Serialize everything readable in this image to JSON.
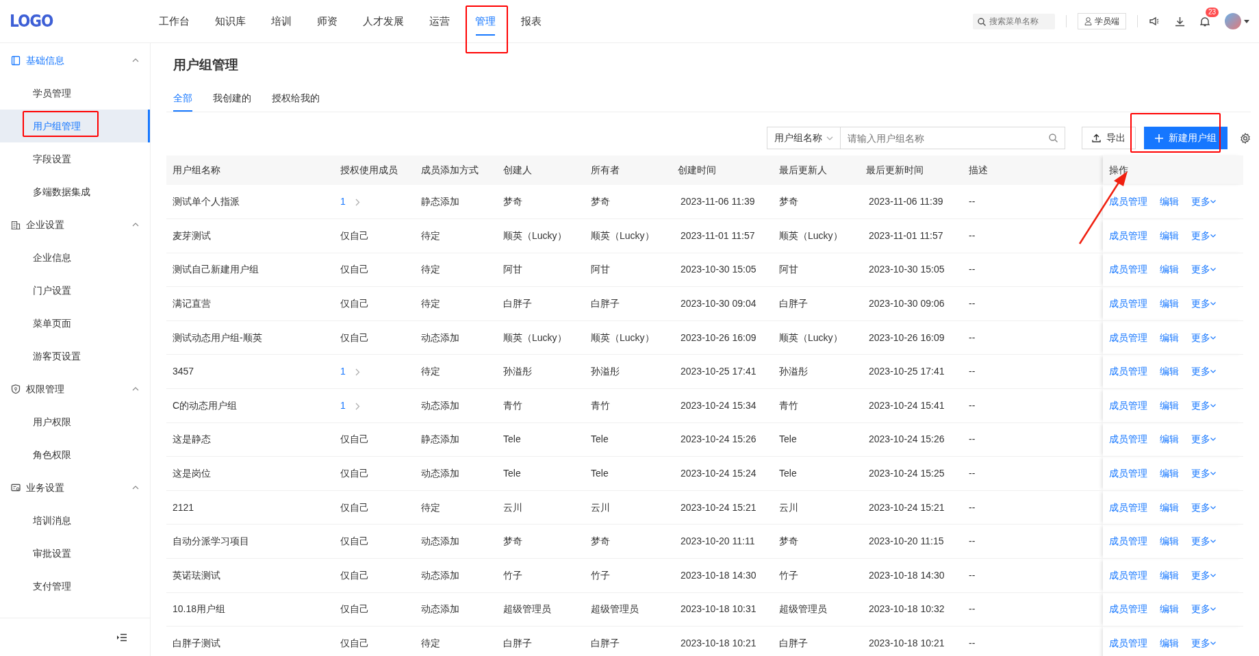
{
  "logo": "LOGO",
  "nav": [
    {
      "label": "工作台",
      "selected": false,
      "highlighted": false
    },
    {
      "label": "知识库",
      "selected": false,
      "highlighted": false
    },
    {
      "label": "培训",
      "selected": false,
      "highlighted": false
    },
    {
      "label": "师资",
      "selected": false,
      "highlighted": false
    },
    {
      "label": "人才发展",
      "selected": false,
      "highlighted": false
    },
    {
      "label": "运营",
      "selected": false,
      "highlighted": false
    },
    {
      "label": "管理",
      "selected": true,
      "highlighted": true
    },
    {
      "label": "报表",
      "selected": false,
      "highlighted": false
    }
  ],
  "header": {
    "search_placeholder": "搜索菜单名称",
    "student_button": "学员端",
    "notification_count": "23"
  },
  "sidebar": {
    "groups": [
      {
        "label": "基础信息",
        "selected": true,
        "expanded": true,
        "items": [
          {
            "label": "学员管理",
            "selected": false,
            "highlighted": false
          },
          {
            "label": "用户组管理",
            "selected": true,
            "highlighted": true
          },
          {
            "label": "字段设置",
            "selected": false,
            "highlighted": false
          },
          {
            "label": "多端数据集成",
            "selected": false,
            "highlighted": false
          }
        ]
      },
      {
        "label": "企业设置",
        "selected": false,
        "expanded": true,
        "items": [
          {
            "label": "企业信息",
            "selected": false,
            "highlighted": false
          },
          {
            "label": "门户设置",
            "selected": false,
            "highlighted": false
          },
          {
            "label": "菜单页面",
            "selected": false,
            "highlighted": false
          },
          {
            "label": "游客页设置",
            "selected": false,
            "highlighted": false
          }
        ]
      },
      {
        "label": "权限管理",
        "selected": false,
        "expanded": true,
        "items": [
          {
            "label": "用户权限",
            "selected": false,
            "highlighted": false
          },
          {
            "label": "角色权限",
            "selected": false,
            "highlighted": false
          }
        ]
      },
      {
        "label": "业务设置",
        "selected": false,
        "expanded": true,
        "items": [
          {
            "label": "培训消息",
            "selected": false,
            "highlighted": false
          },
          {
            "label": "审批设置",
            "selected": false,
            "highlighted": false
          },
          {
            "label": "支付管理",
            "selected": false,
            "highlighted": false
          }
        ]
      }
    ]
  },
  "page_title": "用户组管理",
  "tabs": [
    {
      "label": "全部",
      "selected": true
    },
    {
      "label": "我创建的",
      "selected": false
    },
    {
      "label": "授权给我的",
      "selected": false
    }
  ],
  "toolbar": {
    "filter_select": "用户组名称",
    "search_placeholder": "请输入用户组名称",
    "export_button": "导出",
    "create_button": "新建用户组",
    "create_highlighted": true
  },
  "table": {
    "columns": [
      "用户组名称",
      "授权使用成员",
      "成员添加方式",
      "创建人",
      "所有者",
      "创建时间",
      "最后更新人",
      "最后更新时间",
      "描述",
      "操作"
    ],
    "rows": [
      {
        "kind": "link",
        "cells": [
          "测试单个人指派",
          "1",
          "静态添加",
          "梦奇",
          "梦奇",
          "2023-11-06 11:39",
          "梦奇",
          "2023-11-06 11:39",
          "--"
        ],
        "actions": [
          "成员管理",
          "编辑",
          "更多"
        ]
      },
      {
        "kind": "text",
        "cells": [
          "麦芽测试",
          "仅自己",
          "待定",
          "顺英（Lucky）",
          "顺英（Lucky）",
          "2023-11-01 11:57",
          "顺英（Lucky）",
          "2023-11-01 11:57",
          "--"
        ],
        "actions": [
          "成员管理",
          "编辑",
          "更多"
        ]
      },
      {
        "kind": "text",
        "cells": [
          "测试自己新建用户组",
          "仅自己",
          "待定",
          "阿甘",
          "阿甘",
          "2023-10-30 15:05",
          "阿甘",
          "2023-10-30 15:05",
          "--"
        ],
        "actions": [
          "成员管理",
          "编辑",
          "更多"
        ]
      },
      {
        "kind": "text",
        "cells": [
          "满记直营",
          "仅自己",
          "待定",
          "白胖子",
          "白胖子",
          "2023-10-30 09:04",
          "白胖子",
          "2023-10-30 09:06",
          "--"
        ],
        "actions": [
          "成员管理",
          "编辑",
          "更多"
        ]
      },
      {
        "kind": "text",
        "cells": [
          "测试动态用户组-顺英",
          "仅自己",
          "动态添加",
          "顺英（Lucky）",
          "顺英（Lucky）",
          "2023-10-26 16:09",
          "顺英（Lucky）",
          "2023-10-26 16:09",
          "--"
        ],
        "actions": [
          "成员管理",
          "编辑",
          "更多"
        ]
      },
      {
        "kind": "link",
        "cells": [
          "3457",
          "1",
          "待定",
          "孙溢彤",
          "孙溢彤",
          "2023-10-25 17:41",
          "孙溢彤",
          "2023-10-25 17:41",
          "--"
        ],
        "actions": [
          "成员管理",
          "编辑",
          "更多"
        ]
      },
      {
        "kind": "link",
        "cells": [
          "C的动态用户组",
          "1",
          "动态添加",
          "青竹",
          "青竹",
          "2023-10-24 15:34",
          "青竹",
          "2023-10-24 15:41",
          "--"
        ],
        "actions": [
          "成员管理",
          "编辑",
          "更多"
        ]
      },
      {
        "kind": "text",
        "cells": [
          "这是静态",
          "仅自己",
          "静态添加",
          "Tele",
          "Tele",
          "2023-10-24 15:26",
          "Tele",
          "2023-10-24 15:26",
          "--"
        ],
        "actions": [
          "成员管理",
          "编辑",
          "更多"
        ]
      },
      {
        "kind": "text",
        "cells": [
          "这是岗位",
          "仅自己",
          "动态添加",
          "Tele",
          "Tele",
          "2023-10-24 15:24",
          "Tele",
          "2023-10-24 15:25",
          "--"
        ],
        "actions": [
          "成员管理",
          "编辑",
          "更多"
        ]
      },
      {
        "kind": "text",
        "cells": [
          "2121",
          "仅自己",
          "待定",
          "云川",
          "云川",
          "2023-10-24 15:21",
          "云川",
          "2023-10-24 15:21",
          "--"
        ],
        "actions": [
          "成员管理",
          "编辑",
          "更多"
        ]
      },
      {
        "kind": "text",
        "cells": [
          "自动分派学习项目",
          "仅自己",
          "动态添加",
          "梦奇",
          "梦奇",
          "2023-10-20 11:11",
          "梦奇",
          "2023-10-20 11:15",
          "--"
        ],
        "actions": [
          "成员管理",
          "编辑",
          "更多"
        ]
      },
      {
        "kind": "text",
        "cells": [
          "英诺珐测试",
          "仅自己",
          "动态添加",
          "竹子",
          "竹子",
          "2023-10-18 14:30",
          "竹子",
          "2023-10-18 14:30",
          "--"
        ],
        "actions": [
          "成员管理",
          "编辑",
          "更多"
        ]
      },
      {
        "kind": "text",
        "cells": [
          "10.18用户组",
          "仅自己",
          "动态添加",
          "超级管理员",
          "超级管理员",
          "2023-10-18 10:31",
          "超级管理员",
          "2023-10-18 10:32",
          "--"
        ],
        "actions": [
          "成员管理",
          "编辑",
          "更多"
        ]
      },
      {
        "kind": "text",
        "cells": [
          "白胖子测试",
          "仅自己",
          "待定",
          "白胖子",
          "白胖子",
          "2023-10-18 10:21",
          "白胖子",
          "2023-10-18 10:21",
          "--"
        ],
        "actions": [
          "成员管理",
          "编辑",
          "更多"
        ]
      }
    ]
  }
}
